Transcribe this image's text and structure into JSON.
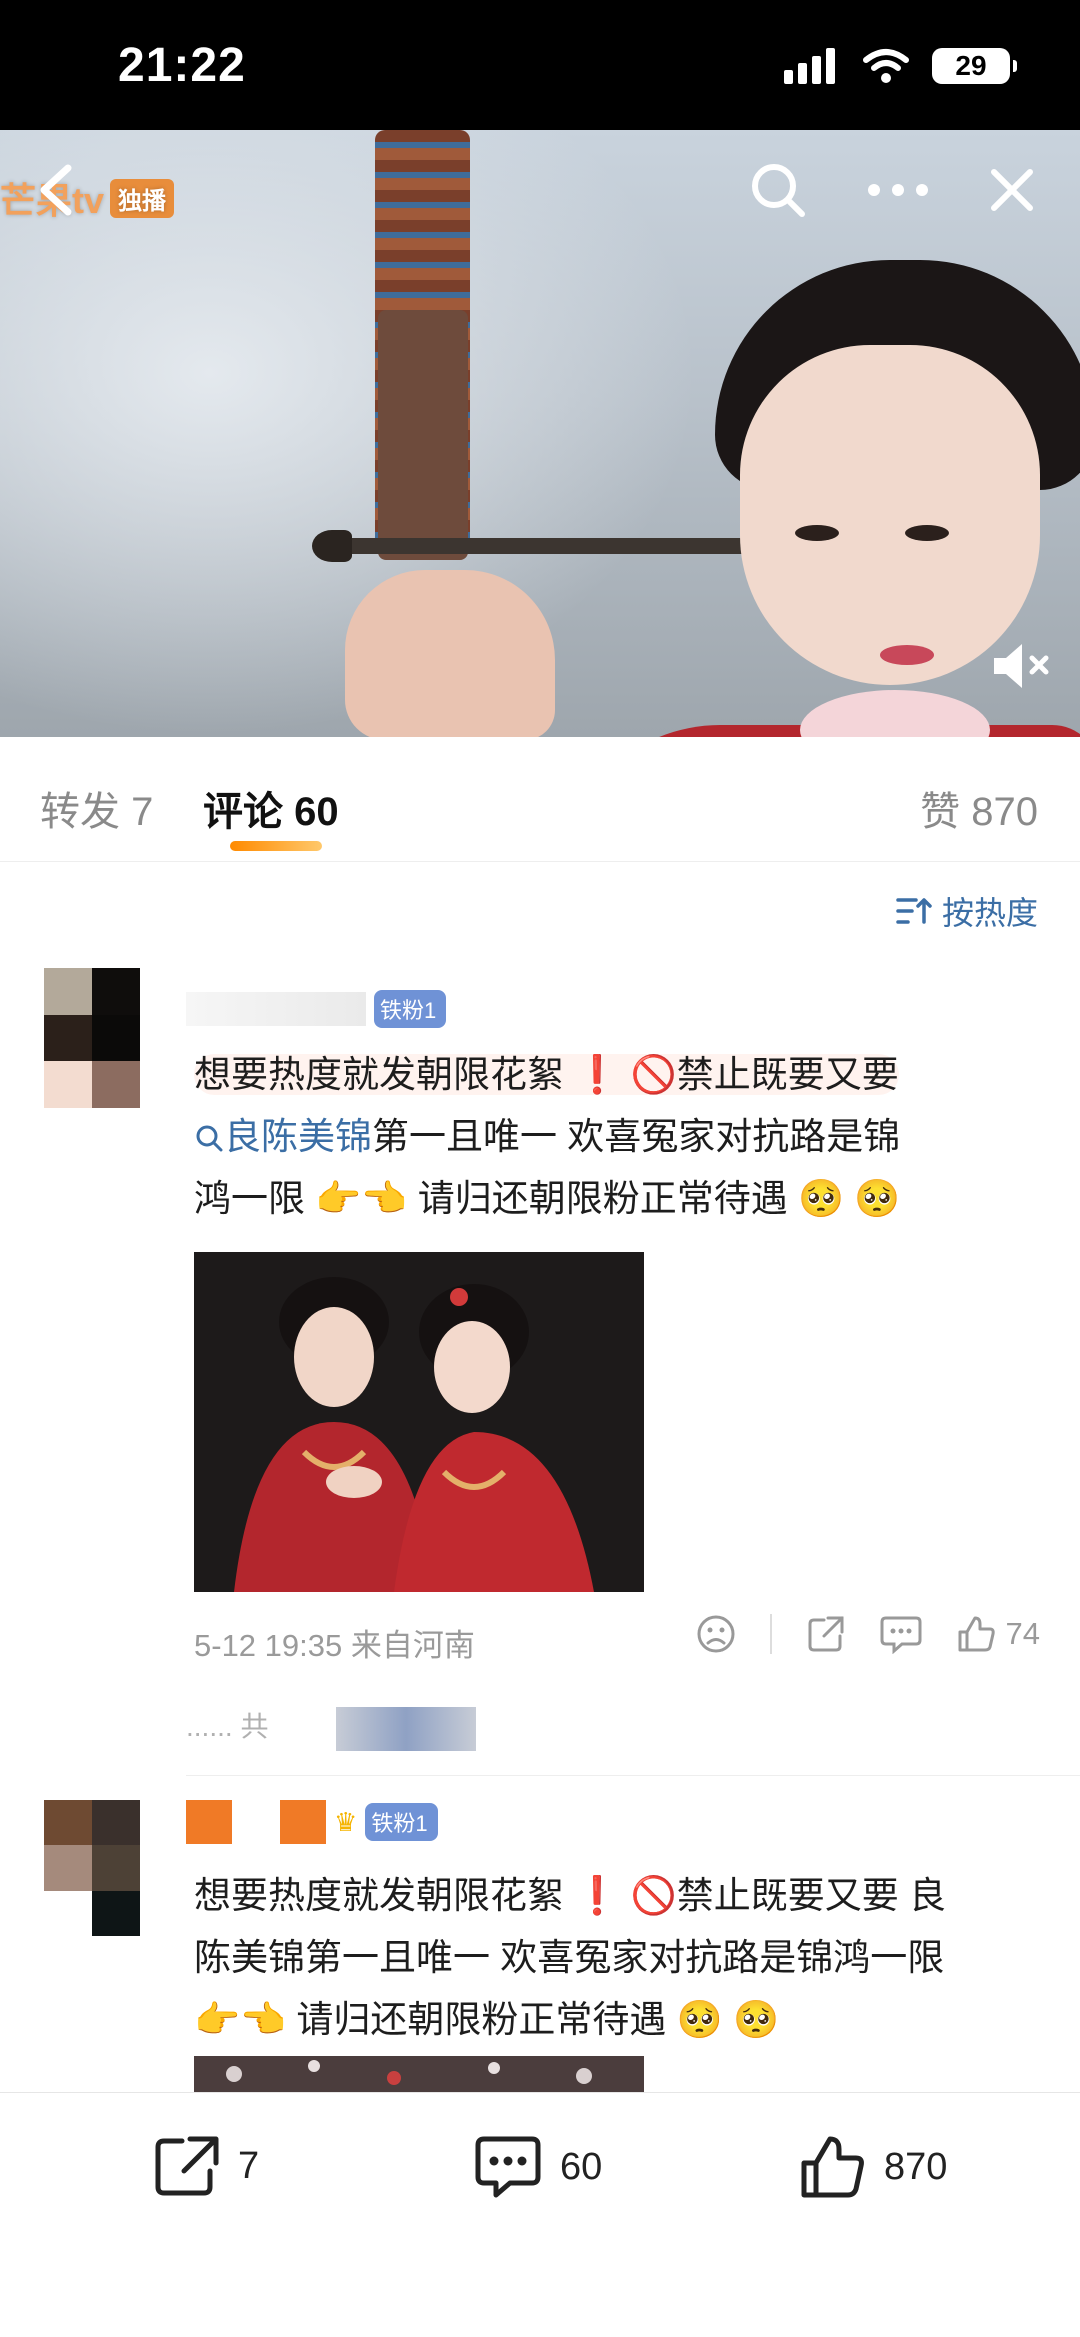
{
  "status_bar": {
    "time": "21:22",
    "battery": "29"
  },
  "video": {
    "logo_text": "芒果tv",
    "logo_badge": "独播",
    "colors": {
      "robe": "#b3262d",
      "sky": "#c9d3dd"
    }
  },
  "tabs": {
    "repost": "转发 7",
    "comments": "评论 60",
    "likes": "赞 870"
  },
  "sort": {
    "label": "按热度"
  },
  "comments": [
    {
      "badge": "铁粉1",
      "text_line1": "想要热度就发朝限花絮",
      "text_after_bang": "禁止既要又要",
      "topic": "良陈美锦",
      "text_line2": "第一且唯一 欢喜冤家对抗路是锦",
      "text_line3a": "鸿一限",
      "text_line3b": "请归还朝限粉正常待遇",
      "date": "5-12 19:35",
      "location": "来自河南",
      "likes": "74",
      "reply_preview": "...... 共"
    },
    {
      "badge": "铁粉1",
      "text_line1": "想要热度就发朝限花絮",
      "text_after_bang": "禁止既要又要  良",
      "text_line2": "陈美锦第一且唯一 欢喜冤家对抗路是锦鸿一限",
      "text_line3": "请归还朝限粉正常待遇"
    }
  ],
  "bottom_bar": {
    "reposts": "7",
    "comments": "60",
    "likes": "870"
  },
  "icons": {
    "status": [
      "signal-icon",
      "wifi-icon",
      "battery-icon"
    ],
    "video": [
      "back-icon",
      "search-icon",
      "more-icon",
      "close-icon",
      "mute-icon"
    ],
    "comment_actions": [
      "dislike-icon",
      "share-icon",
      "comment-icon",
      "like-icon"
    ]
  },
  "colors": {
    "accent": "#ff8a00",
    "link": "#3b6ea5",
    "badge": "#6f92d6"
  }
}
